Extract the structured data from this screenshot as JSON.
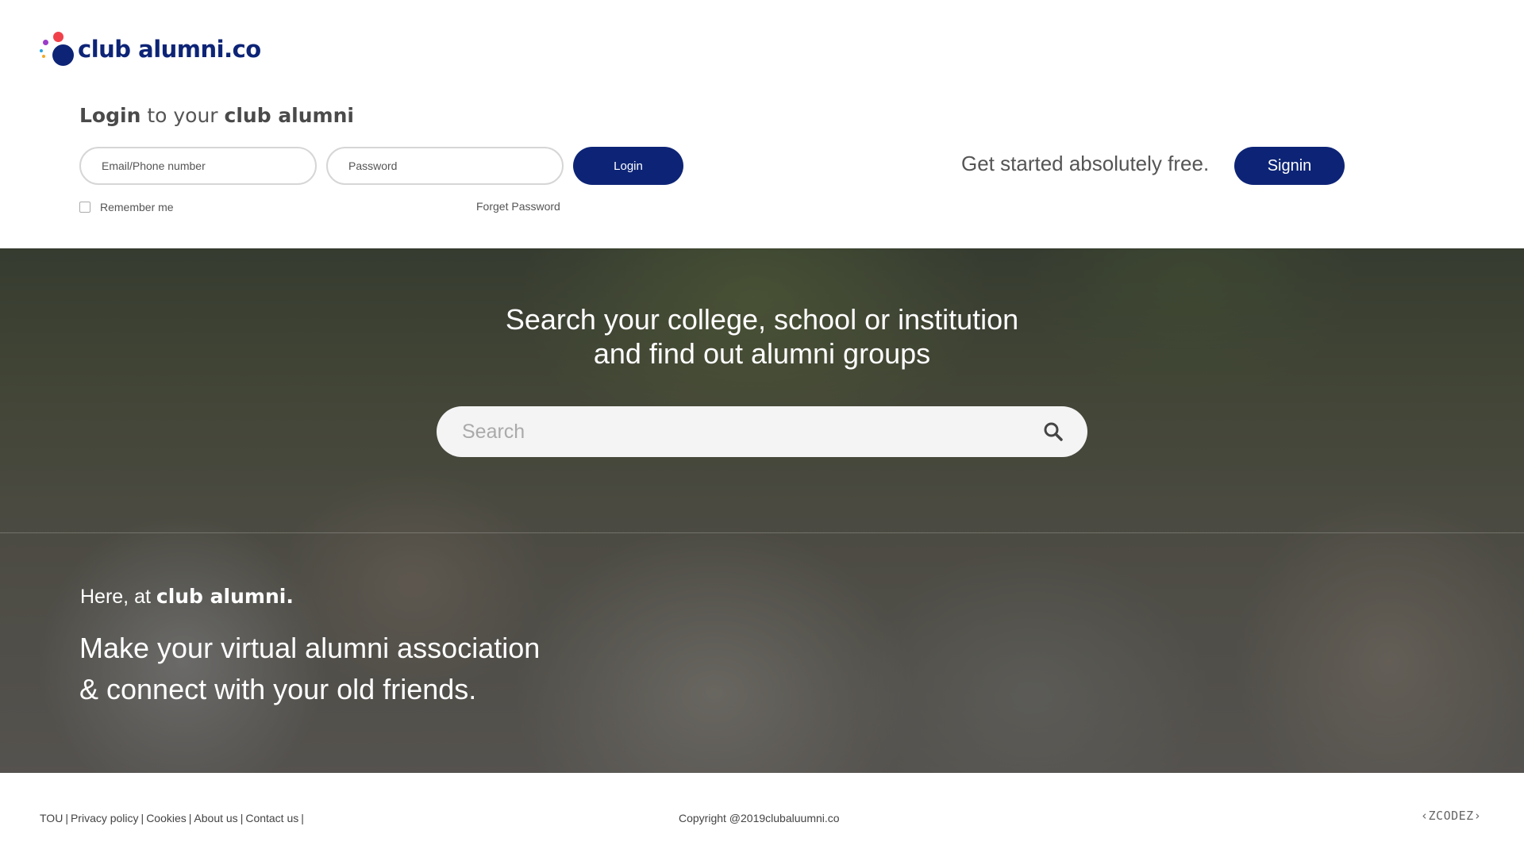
{
  "header": {
    "logo_text": "club alumni.co"
  },
  "login": {
    "heading_strong": "Login",
    "heading_mid": " to your ",
    "heading_brand": "club alumni",
    "email_placeholder": "Email/Phone number",
    "password_placeholder": "Password",
    "login_button": "Login",
    "remember_label": "Remember me",
    "forget_link": "Forget Password"
  },
  "signup": {
    "prompt": "Get started absolutely free.",
    "signin_button": "Signin"
  },
  "hero": {
    "title_line1": "Search your college, school or institution",
    "title_line2": "and find out alumni groups",
    "search_placeholder": "Search",
    "tagline_prefix": "Here, at ",
    "tagline_brand": "club alumni.",
    "tagline_line1": "Make your virtual alumni association",
    "tagline_line2": "& connect with your old friends."
  },
  "footer": {
    "links": [
      "TOU",
      "Privacy policy",
      "Cookies",
      "About us",
      "Contact us"
    ],
    "copyright": "Copyright @2019clubaluumni.co",
    "brand_mark": "‹ZCODEZ›"
  },
  "icons": {
    "search": "search-icon",
    "logo": "logo-icon",
    "checkbox": "checkbox-icon"
  },
  "colors": {
    "primary": "#0d2476",
    "logo_red": "#f0414b",
    "logo_purple": "#9b3cc9",
    "logo_blue": "#27a3e0",
    "logo_orange": "#f6a623"
  }
}
